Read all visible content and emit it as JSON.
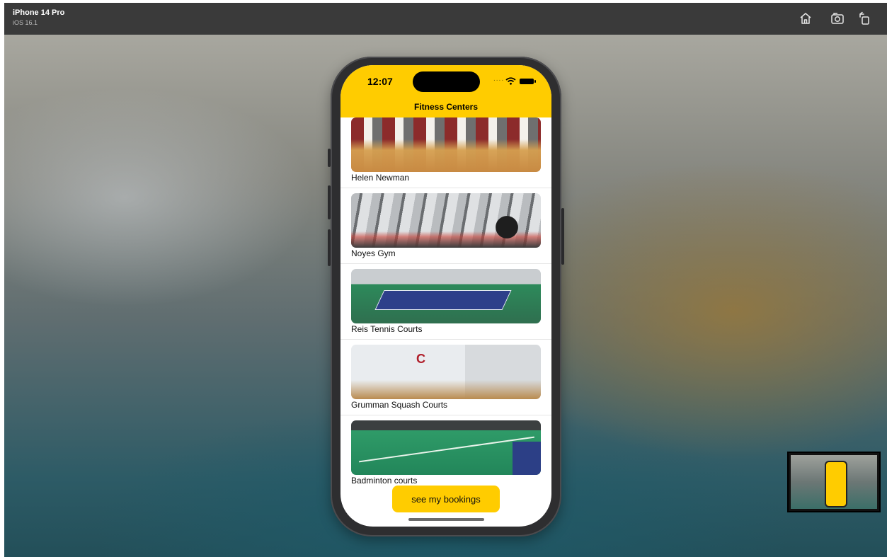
{
  "simulator": {
    "device_name": "iPhone 14 Pro",
    "os_version": "iOS 16.1",
    "toolbar_icons": [
      "home-icon",
      "screenshot-icon",
      "rotate-icon"
    ]
  },
  "status_bar": {
    "time": "12:07",
    "signal": "....",
    "icons": [
      "wifi-icon",
      "battery-icon"
    ]
  },
  "app": {
    "nav_title": "Fitness Centers",
    "accent_color": "#ffcc00",
    "facilities": [
      {
        "label": "Helen Newman"
      },
      {
        "label": "Noyes Gym"
      },
      {
        "label": "Reis Tennis Courts"
      },
      {
        "label": "Grumman Squash Courts"
      },
      {
        "label": "Badminton courts"
      }
    ],
    "bookings_button": "see my bookings"
  }
}
